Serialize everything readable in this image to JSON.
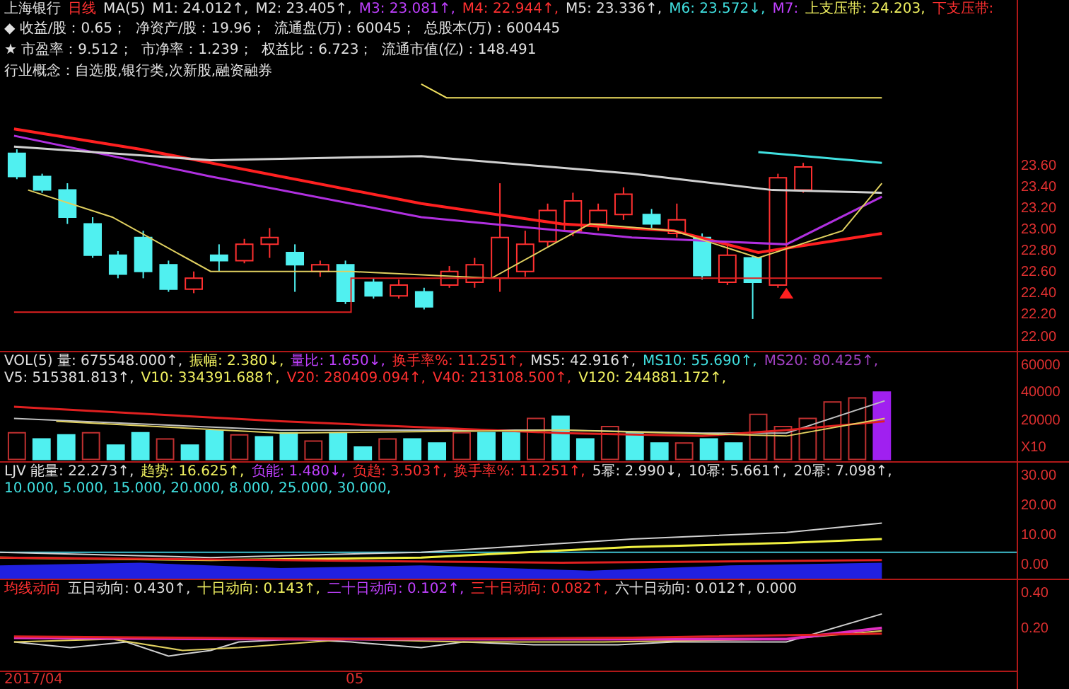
{
  "main": {
    "legend": [
      {
        "text": "上海银行",
        "color": "#e0e0e0"
      },
      {
        "text": "日线",
        "color": "#ff3030"
      },
      {
        "text": "MA(5)",
        "color": "#e0e0e0"
      },
      {
        "text": "M1: 24.012↑,",
        "color": "#e0e0e0"
      },
      {
        "text": "M2: 23.405↑,",
        "color": "#e0e0e0"
      },
      {
        "text": "M3: 23.081↑,",
        "color": "#c040ff"
      },
      {
        "text": "M4: 22.944↑,",
        "color": "#ff3030"
      },
      {
        "text": "M5: 23.336↑,",
        "color": "#e0e0e0"
      },
      {
        "text": "M6: 23.572↓,",
        "color": "#40e0e0"
      },
      {
        "text": "M7:",
        "color": "#c040ff"
      },
      {
        "text": "上支压带: 24.203,",
        "color": "#f0f060"
      },
      {
        "text": "下支压带:",
        "color": "#ff3030"
      }
    ],
    "info": [
      "◆ 收益/股：0.65；  净资产/股：19.96；  流通盘(万)：60045；  总股本(万)：600445",
      "★ 市盈率：9.512；  市净率：1.239；  权益比：6.723；  流通市值(亿)：148.491",
      "行业概念：自选股,银行类,次新股,融资融券"
    ],
    "axis": [
      "23.60",
      "23.40",
      "23.20",
      "23.00",
      "22.80",
      "22.60",
      "22.40",
      "22.20",
      "22.00"
    ]
  },
  "volume": {
    "legend": [
      {
        "text": "VOL(5) 量: 675548.000↑,",
        "color": "#e0e0e0"
      },
      {
        "text": "振幅: 2.380↓,",
        "color": "#f0f060"
      },
      {
        "text": "量比: 1.650↓,",
        "color": "#c040ff"
      },
      {
        "text": "换手率%: 11.251↑,",
        "color": "#ff3030"
      },
      {
        "text": "MS5: 42.916↑,",
        "color": "#e0e0e0"
      },
      {
        "text": "MS10: 55.690↑,",
        "color": "#40e0e0"
      },
      {
        "text": "MS20: 80.425↑,",
        "color": "#a040c0"
      },
      {
        "text": "V5: 515381.813↑,",
        "color": "#e0e0e0"
      },
      {
        "text": "V10: 334391.688↑,",
        "color": "#f0f060"
      },
      {
        "text": "V20: 280409.094↑,",
        "color": "#ff3030"
      },
      {
        "text": "V40: 213108.500↑,",
        "color": "#ff3030"
      },
      {
        "text": "V120: 244881.172↑,",
        "color": "#f0f060"
      }
    ],
    "axis": [
      "60000",
      "40000",
      "20000",
      "X10"
    ]
  },
  "ljv": {
    "legend": [
      {
        "text": "LJV 能量: 22.273↑,",
        "color": "#e0e0e0"
      },
      {
        "text": "趋势: 16.625↑,",
        "color": "#f0f060"
      },
      {
        "text": "负能: 1.480↓,",
        "color": "#c040ff"
      },
      {
        "text": "负趋: 3.503↑,",
        "color": "#ff3030"
      },
      {
        "text": "换手率%: 11.251↑,",
        "color": "#ff3030"
      },
      {
        "text": "5幂: 2.990↓,",
        "color": "#e0e0e0"
      },
      {
        "text": "10幂: 5.661↑,",
        "color": "#e0e0e0"
      },
      {
        "text": "20幂: 7.098↑,",
        "color": "#e0e0e0"
      },
      {
        "text": "10.000, 5.000, 15.000, 20.000, 8.000, 25.000, 30.000,",
        "color": "#40e0e0"
      }
    ],
    "axis": [
      "30.00",
      "20.00",
      "10.00",
      "0.00"
    ]
  },
  "trend": {
    "legend": [
      {
        "text": "均线动向",
        "color": "#ff3030"
      },
      {
        "text": "五日动向: 0.430↑,",
        "color": "#e0e0e0"
      },
      {
        "text": "十日动向: 0.143↑,",
        "color": "#f0f060"
      },
      {
        "text": "二十日动向: 0.102↑,",
        "color": "#c040ff"
      },
      {
        "text": "三十日动向: 0.082↑,",
        "color": "#ff3030"
      },
      {
        "text": "六十日动向: 0.012↑, 0.000",
        "color": "#e0e0e0"
      }
    ],
    "axis": [
      "0.40",
      "0.20"
    ],
    "dates": [
      "2017/04",
      "05"
    ]
  }
}
